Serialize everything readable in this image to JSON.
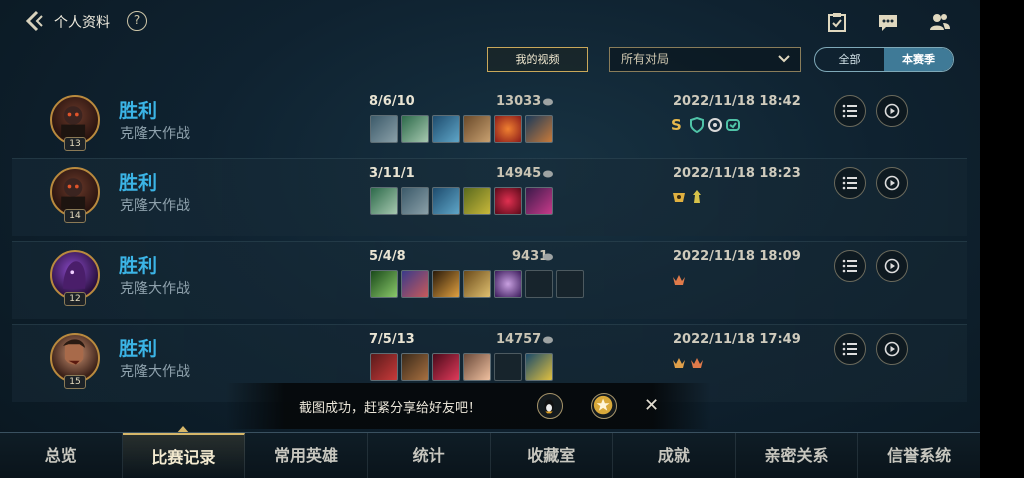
{
  "header": {
    "title": "个人资料",
    "help_label": "?",
    "back_icon": "back-chevron-icon",
    "top_icons": [
      "checklist-icon",
      "chat-icon",
      "friends-icon"
    ]
  },
  "filters": {
    "video_button_label": "我的视频",
    "mode_select_value": "所有对局",
    "toggle_all_label": "全部",
    "toggle_season_label": "本赛季"
  },
  "matches": [
    {
      "result": "胜利",
      "mode": "克隆大作战",
      "level": "13",
      "kda": "8/6/10",
      "gold": "13033",
      "datetime": "2022/11/18 18:42",
      "has_s_badge": true
    },
    {
      "result": "胜利",
      "mode": "克隆大作战",
      "level": "14",
      "kda": "3/11/1",
      "gold": "14945",
      "datetime": "2022/11/18 18:23",
      "has_s_badge": false
    },
    {
      "result": "胜利",
      "mode": "克隆大作战",
      "level": "12",
      "kda": "5/4/8",
      "gold": "9431",
      "datetime": "2022/11/18 18:09",
      "has_s_badge": false
    },
    {
      "result": "胜利",
      "mode": "克隆大作战",
      "level": "15",
      "kda": "7/5/13",
      "gold": "14757",
      "datetime": "2022/11/18 17:49",
      "has_s_badge": false
    }
  ],
  "toast": {
    "message": "截图成功，赶紧分享给好友吧！",
    "close_label": "✕"
  },
  "bottom_nav": [
    {
      "label": "总览",
      "active": false
    },
    {
      "label": "比赛记录",
      "active": true
    },
    {
      "label": "常用英雄",
      "active": false
    },
    {
      "label": "统计",
      "active": false
    },
    {
      "label": "收藏室",
      "active": false
    },
    {
      "label": "成就",
      "active": false
    },
    {
      "label": "亲密关系",
      "active": false
    },
    {
      "label": "信誉系统",
      "active": false
    }
  ],
  "colors": {
    "victory": "#3bb4e6",
    "gold_accent": "#d7b76a",
    "toggle_active": "#3f7a97"
  }
}
